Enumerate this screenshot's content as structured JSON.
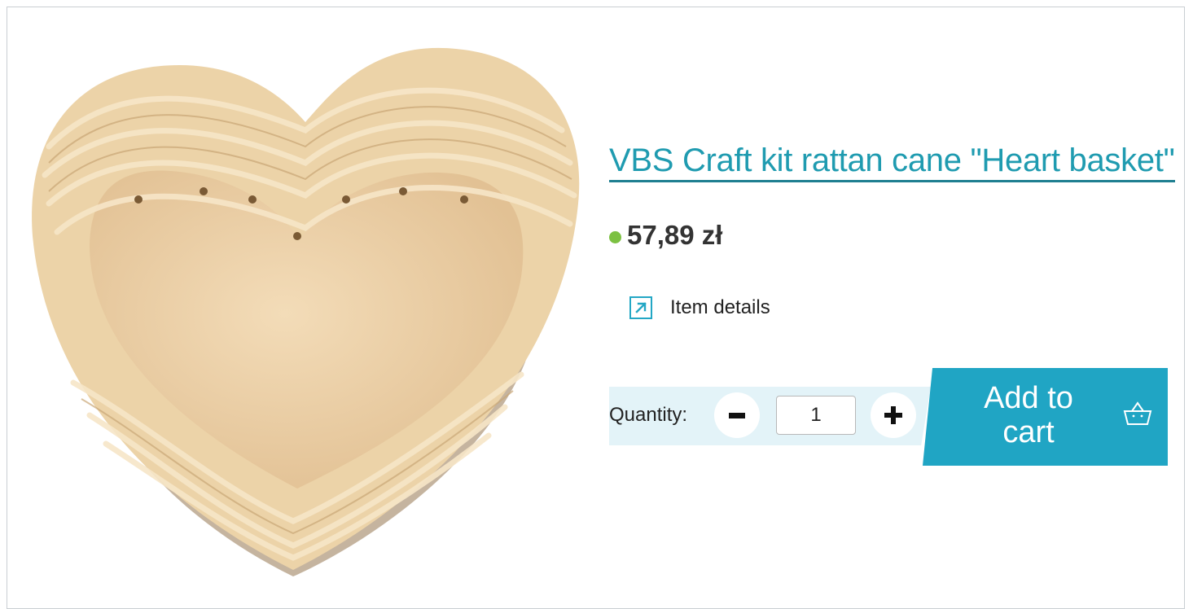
{
  "product": {
    "title": "VBS Craft kit rattan cane \"Heart basket\"",
    "price": "57,89 zł",
    "availability_color": "#7cc142",
    "image_icon": "heart-basket-photo"
  },
  "details": {
    "label": "Item details",
    "icon": "external-link-icon"
  },
  "quantity": {
    "label": "Quantity:",
    "value": "1",
    "decrement_icon": "minus-icon",
    "increment_icon": "plus-icon"
  },
  "cart": {
    "label_line1": "Add to",
    "label_line2": "cart",
    "icon": "basket-icon",
    "accent_color": "#20a5c4"
  }
}
